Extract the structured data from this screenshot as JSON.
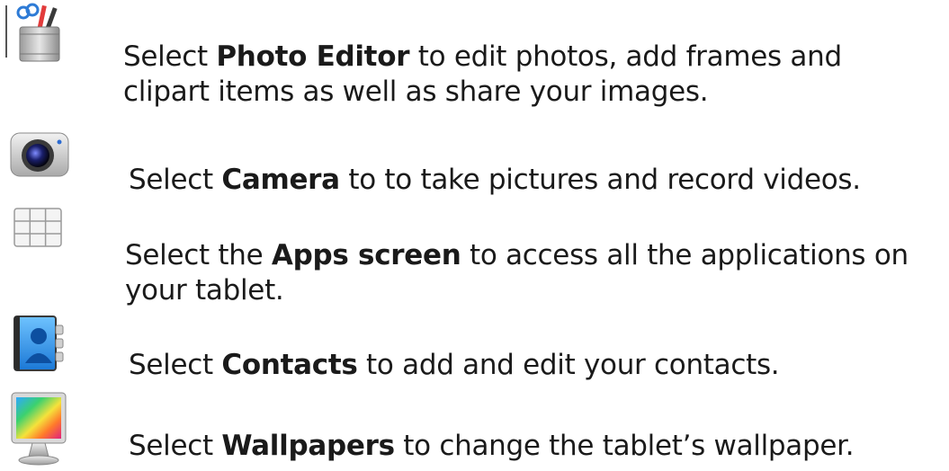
{
  "items": [
    {
      "icon": "photo-editor-icon",
      "prefix": "Select ",
      "bold": "Photo Editor",
      "suffix": " to edit photos, add frames and clipart items as well as share your images."
    },
    {
      "icon": "camera-icon",
      "prefix": "Select ",
      "bold": "Camera",
      "suffix": " to to take pictures and record videos."
    },
    {
      "icon": "apps-grid-icon",
      "prefix": "Select the ",
      "bold": "Apps screen",
      "suffix": " to access all the applications on your tablet."
    },
    {
      "icon": "contacts-icon",
      "prefix": "Select ",
      "bold": "Contacts",
      "suffix": " to add and edit your contacts."
    },
    {
      "icon": "wallpapers-icon",
      "prefix": "Select ",
      "bold": "Wallpapers",
      "suffix": " to change the tablet’s wallpaper."
    }
  ]
}
